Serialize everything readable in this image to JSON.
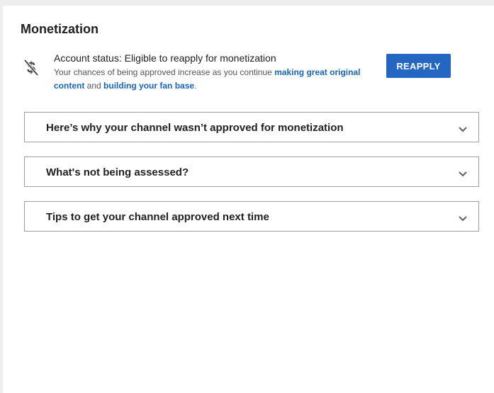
{
  "page": {
    "title": "Monetization"
  },
  "status": {
    "icon": "no-dollar-icon",
    "account_status": "Account status: Eligible to reapply for monetization",
    "desc_prefix": "Your chances of being approved increase as you continue ",
    "link_1": "making great original content",
    "desc_middle": " and ",
    "link_2": "building your fan base",
    "desc_suffix": ".",
    "reapply_label": "REAPPLY"
  },
  "colors": {
    "accent": "#2467c3",
    "link": "#1565c0"
  },
  "accordions": [
    {
      "label": "Here’s why your channel wasn’t approved for monetization",
      "icon": "chevron-down-icon"
    },
    {
      "label": "What's not being assessed?",
      "icon": "chevron-down-icon"
    },
    {
      "label": "Tips to get your channel approved next time",
      "icon": "chevron-down-icon"
    }
  ]
}
